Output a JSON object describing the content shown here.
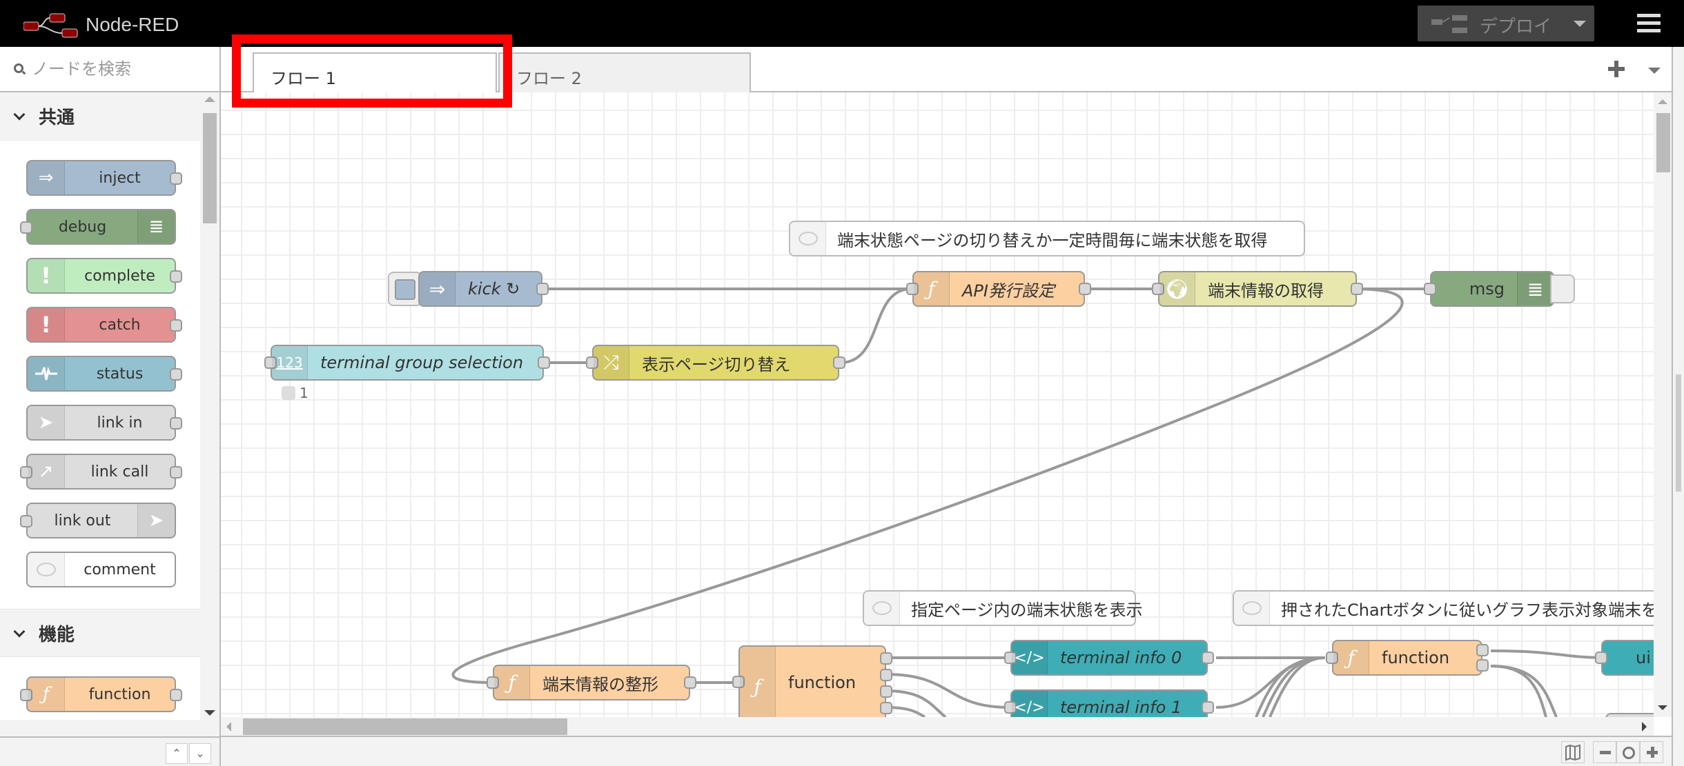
{
  "header": {
    "app_title": "Node-RED",
    "deploy_label": "デプロイ",
    "menu_icon": "hamburger-menu-icon"
  },
  "palette": {
    "search_placeholder": "ノードを検索",
    "categories": [
      {
        "label": "共通",
        "nodes": [
          {
            "label": "inject",
            "icon": "arrow-right-icon",
            "color": "#a6bbcf"
          },
          {
            "label": "debug",
            "icon": "list-icon",
            "color": "#87a980"
          },
          {
            "label": "complete",
            "icon": "exclamation-icon",
            "color": "#c0edc0"
          },
          {
            "label": "catch",
            "icon": "exclamation-icon",
            "color": "#e49191"
          },
          {
            "label": "status",
            "icon": "pulse-icon",
            "color": "#94c1d0"
          },
          {
            "label": "link in",
            "icon": "link-in-icon",
            "color": "#dddddd"
          },
          {
            "label": "link call",
            "icon": "link-call-icon",
            "color": "#dddddd"
          },
          {
            "label": "link out",
            "icon": "link-out-icon",
            "color": "#dddddd"
          },
          {
            "label": "comment",
            "icon": "comment-icon",
            "color": "#ffffff"
          }
        ]
      },
      {
        "label": "機能",
        "nodes": [
          {
            "label": "function",
            "icon": "function-icon",
            "color": "#fdd0a2"
          }
        ]
      }
    ]
  },
  "workspace": {
    "tabs": [
      {
        "label": "フロー 1",
        "active": true
      },
      {
        "label": "フロー 2",
        "active": false
      }
    ],
    "nodes": {
      "kick": {
        "label": "kick ↻",
        "color": "#a6bbcf"
      },
      "terminal_group_selection": {
        "label": "terminal group selection",
        "color": "#b0dfe3",
        "status": "1"
      },
      "page_switch": {
        "label": "表示ページ切り替え",
        "color": "#e2d96e"
      },
      "api_setting": {
        "label": "API発行設定",
        "color": "#fdd0a2"
      },
      "get_terminal_info": {
        "label": "端末情報の取得",
        "color": "#e7e7ae"
      },
      "msg_debug": {
        "label": "msg",
        "color": "#87a980"
      },
      "format_terminal_info": {
        "label": "端末情報の整形",
        "color": "#fdd0a2"
      },
      "function_main": {
        "label": "function",
        "color": "#fdd0a2"
      },
      "terminal_info_0": {
        "label": "terminal info 0",
        "color": "#3fadb5"
      },
      "terminal_info_1": {
        "label": "terminal info 1",
        "color": "#3fadb5"
      },
      "function_chart": {
        "label": "function",
        "color": "#fdd0a2"
      },
      "ui_node": {
        "label": "ui c",
        "color": "#3fadb5"
      }
    },
    "comments": {
      "c1": "端末状態ページの切り替えか一定時間毎に端末状態を取得",
      "c2": "指定ページ内の端末状態を表示",
      "c3": "押されたChartボタンに従いグラフ表示対象端末を"
    }
  },
  "colors": {
    "header_bg": "#000000",
    "highlight": "#ff0000",
    "wire": "#999999"
  }
}
